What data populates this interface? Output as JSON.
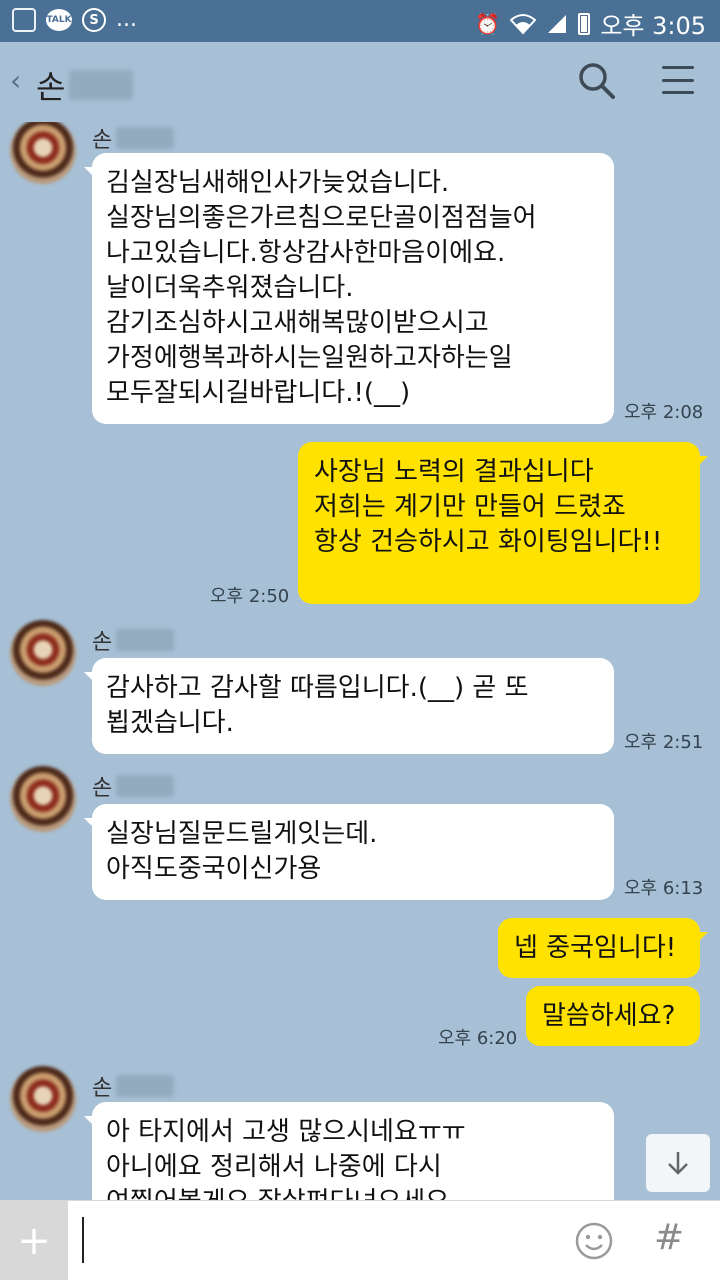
{
  "status_bar": {
    "talk_label": "TALK",
    "s_label": "S",
    "more": "...",
    "clock": "오후 3:05",
    "icons": [
      "image-icon",
      "talk-icon",
      "s-app-icon",
      "alarm-icon",
      "wifi-icon",
      "signal-icon",
      "battery-icon"
    ]
  },
  "header": {
    "back_glyph": "‹",
    "title": "손"
  },
  "messages": [
    {
      "id": "m1",
      "direction": "in",
      "sender": "손",
      "text": "김실장님새해인사가늦었습니다.\n실장님의좋은가르침으로단골이점점늘어\n나고있습니다.항상감사한마음이에요.\n날이더욱추워졌습니다.\n감기조심하시고새해복많이받으시고\n가정에행복과하시는일원하고자하는일\n모두잘되시길바랍니다.!(__)",
      "time": "오후 2:08"
    },
    {
      "id": "m2",
      "direction": "out",
      "text": "사장님 노력의 결과십니다\n저희는 계기만 만들어 드렸죠\n항상 건승하시고 화이팅임니다!!",
      "time": "오후 2:50"
    },
    {
      "id": "m3",
      "direction": "in",
      "sender": "손",
      "text": "감사하고 감사할 따름입니다.(__) 곧 또\n뵙겠습니다.",
      "time": "오후 2:51"
    },
    {
      "id": "m4",
      "direction": "in",
      "sender": "손",
      "text": "실장님질문드릴게잇는데.\n아직도중국이신가용",
      "time": "오후 6:13"
    },
    {
      "id": "m5",
      "direction": "out",
      "text": "넵 중국임니다!",
      "time": ""
    },
    {
      "id": "m6",
      "direction": "out",
      "text": "말씀하세요?",
      "time": "오후 6:20"
    },
    {
      "id": "m7",
      "direction": "in",
      "sender": "손",
      "text": "아 타지에서 고생 많으시네요ㅠㅠ\n아니에요 정리해서 나중에 다시\n여쭤어볼게요 잘살펴다녀오세요",
      "time": ""
    }
  ],
  "input_bar": {
    "plus_label": "+",
    "hash_label": "#",
    "placeholder": ""
  },
  "colors": {
    "chat_background": "#a7c0d6",
    "status_bar": "#4a7096",
    "outgoing_bubble": "#ffe200",
    "incoming_bubble": "#ffffff"
  }
}
